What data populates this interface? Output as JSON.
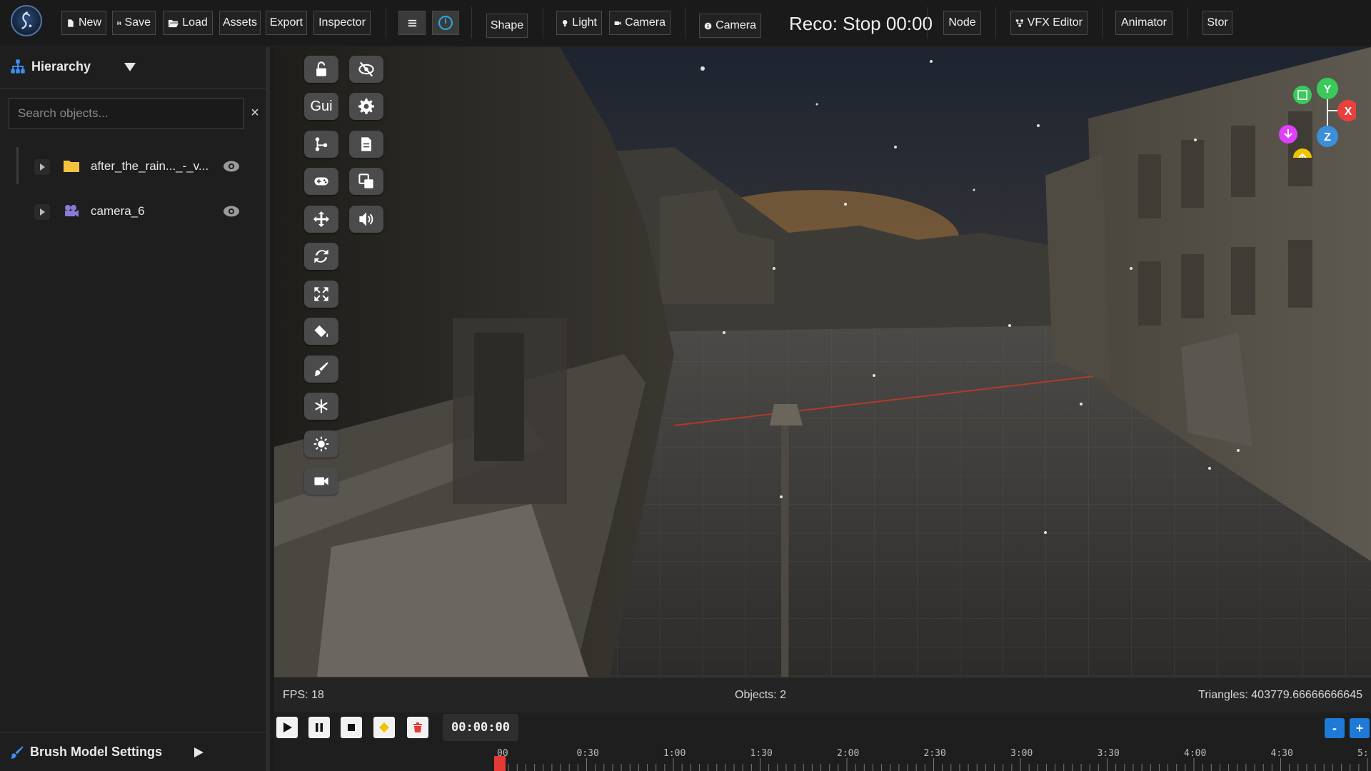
{
  "toolbar": {
    "new": "New",
    "save": "Save",
    "load": "Load",
    "assets": "Assets",
    "export": "Export",
    "inspector": "Inspector",
    "shape": "Shape",
    "light": "Light",
    "camera": "Camera",
    "camera2": "Camera",
    "reco": "Reco: Stop 00:00",
    "node": "Node",
    "vfx_editor": "VFX Editor",
    "animator": "Animator",
    "stor": "Stor"
  },
  "hierarchy": {
    "title": "Hierarchy",
    "search_placeholder": "Search objects...",
    "clear_symbol": "×",
    "items": [
      {
        "label": "after_the_rain..._-_v...",
        "icon": "folder-icon"
      },
      {
        "label": "camera_6",
        "icon": "camera-icon"
      }
    ]
  },
  "brush": {
    "title": "Brush Model Settings"
  },
  "viewport_tools": {
    "gui_label": "Gui",
    "left_column": [
      "unlock-icon",
      "gui-text",
      "branch-icon",
      "gamepad-icon",
      "move-icon",
      "rotate-icon",
      "scale-icon",
      "paint-bucket-icon",
      "brush-icon",
      "snowflake-icon",
      "sun-icon",
      "video-camera-icon"
    ],
    "right_column": [
      "eye-slash-icon",
      "gear-icon",
      "document-icon",
      "copy-icon",
      "volume-icon"
    ]
  },
  "gizmo": {
    "x": "X",
    "y": "Y",
    "z": "Z"
  },
  "status": {
    "fps": "FPS: 18",
    "objects": "Objects: 2",
    "triangles": "Triangles: 403779.66666666645"
  },
  "timeline": {
    "timecode": "00:00:00",
    "zoom_out": "-",
    "zoom_in": "+",
    "ticks": [
      "00",
      "0:30",
      "1:00",
      "1:30",
      "2:00",
      "2:30",
      "3:00",
      "3:30",
      "4:00",
      "4:30",
      "5:"
    ]
  },
  "colors": {
    "accent_blue": "#3d8ff0",
    "record_red": "#e53935",
    "keyframe_yellow": "#f2c200",
    "axis_x": "#e8413c",
    "axis_y": "#3bc95a",
    "axis_z": "#3b8fd9"
  }
}
